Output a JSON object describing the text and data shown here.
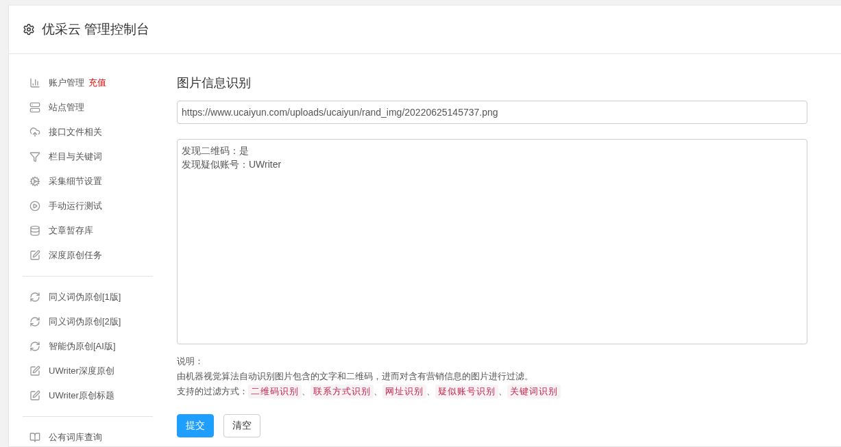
{
  "header": {
    "title": "优采云 管理控制台"
  },
  "sidebar": {
    "groups": [
      {
        "items": [
          {
            "label": "账户管理",
            "badge": "充值"
          },
          {
            "label": "站点管理"
          },
          {
            "label": "接口文件相关"
          },
          {
            "label": "栏目与关键词"
          },
          {
            "label": "采集细节设置"
          },
          {
            "label": "手动运行测试"
          },
          {
            "label": "文章暂存库"
          },
          {
            "label": "深度原创任务"
          }
        ]
      },
      {
        "items": [
          {
            "label": "同义词伪原创[1版]"
          },
          {
            "label": "同义词伪原创[2版]"
          },
          {
            "label": "智能伪原创[AI版]"
          },
          {
            "label": "UWriter深度原创"
          },
          {
            "label": "UWriter原创标题"
          }
        ]
      },
      {
        "items": [
          {
            "label": "公有词库查询"
          }
        ]
      }
    ]
  },
  "main": {
    "title": "图片信息识别",
    "url_field": {
      "value": "https://www.ucaiyun.com/uploads/ucaiyun/rand_img/20220625145737.png"
    },
    "result_box": {
      "lines": [
        "发现二维码：是",
        "发现疑似账号：UWriter"
      ]
    },
    "notes_heading": "说明：",
    "description": "由机器视觉算法自动识别图片包含的文字和二维码，进而对含有营销信息的图片进行过滤。",
    "filters_label": "支持的过滤方式：",
    "filter_separator": "、",
    "filters": [
      "二维码识别",
      "联系方式识别",
      "网址识别",
      "疑似账号识别",
      "关键词识别"
    ],
    "buttons": [
      {
        "label": "提交",
        "kind": "primary"
      },
      {
        "label": "清空",
        "kind": "default"
      }
    ]
  }
}
